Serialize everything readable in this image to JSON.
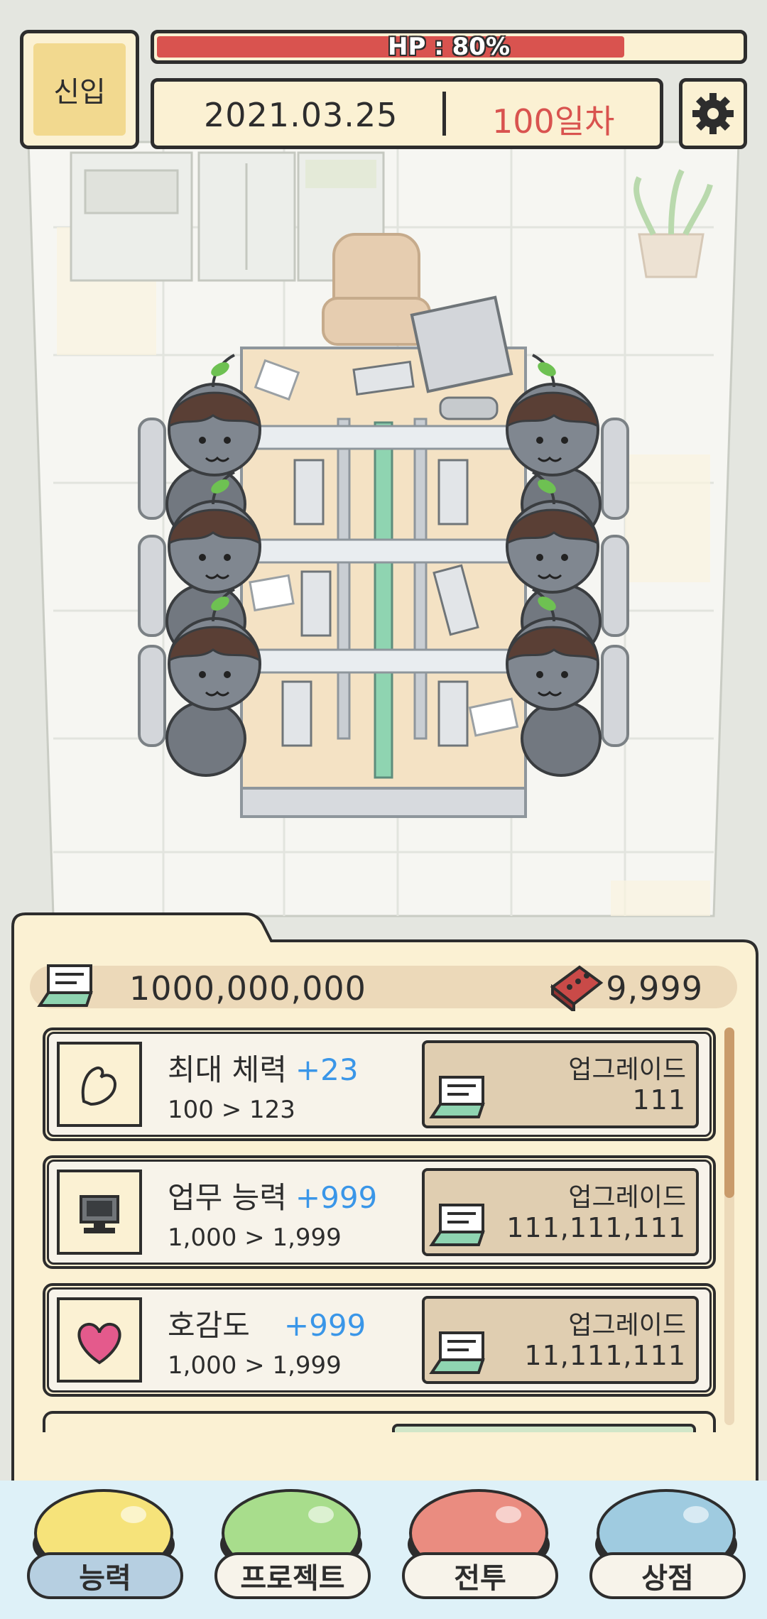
{
  "header": {
    "rank": "신입",
    "hp_text": "HP : 80%",
    "hp_fraction": 0.8,
    "date": "2021.03.25",
    "day": "100일차"
  },
  "resources": {
    "money": "1000,000,000",
    "bricks": "9,999"
  },
  "stats": [
    {
      "name": "최대 체력",
      "bonus": "+23",
      "range": "100 > 123",
      "button": "업그레이드",
      "cost": "111",
      "icon": "muscle-icon"
    },
    {
      "name": "업무 능력",
      "bonus": "+999",
      "range": "1,000 > 1,999",
      "button": "업그레이드",
      "cost": "111,111,111",
      "icon": "computer-icon"
    },
    {
      "name": "호감도",
      "bonus": "+999",
      "range": "1,000 > 1,999",
      "button": "업그레이드",
      "cost": "11,111,111",
      "icon": "heart-icon"
    }
  ],
  "nav": [
    {
      "label": "능력",
      "color": "#f6e37a",
      "active": true
    },
    {
      "label": "프로젝트",
      "color": "#a8dd8c",
      "active": false
    },
    {
      "label": "전투",
      "color": "#ea8c80",
      "active": false
    },
    {
      "label": "상점",
      "color": "#9fcbe0",
      "active": false
    }
  ],
  "colors": {
    "hp_bar": "#d9534f",
    "day_text": "#d9534f",
    "bonus_text": "#3a96e8",
    "panel_bg": "#fbf1d3"
  }
}
